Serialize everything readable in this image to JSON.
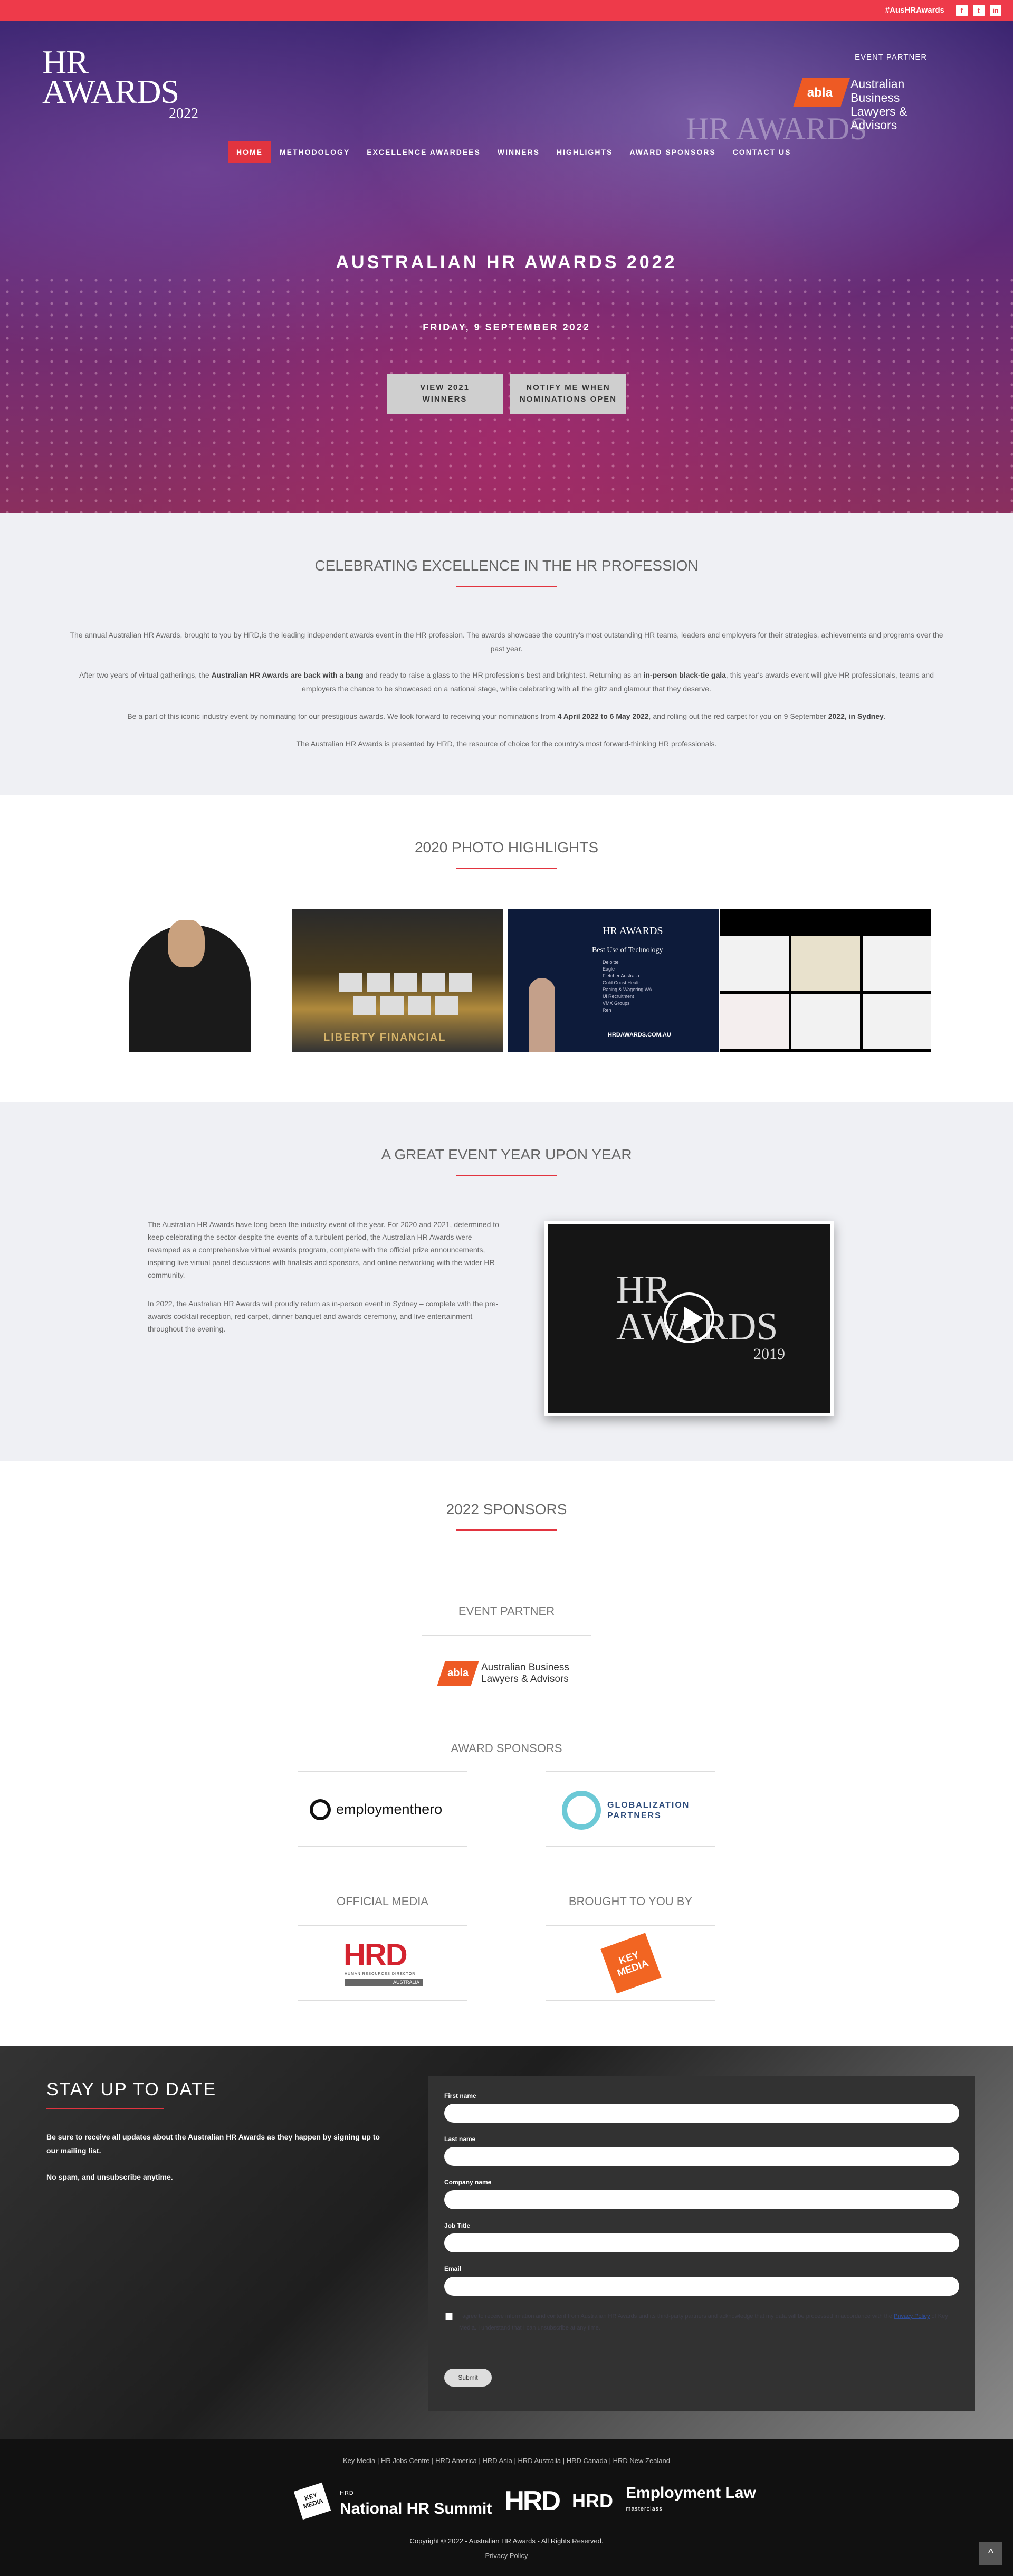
{
  "topbar": {
    "hashtag": "#AusHRAwards",
    "social": [
      {
        "icon": "facebook-icon",
        "glyph": "f"
      },
      {
        "icon": "twitter-icon",
        "glyph": "t"
      },
      {
        "icon": "linkedin-icon",
        "glyph": "in"
      }
    ]
  },
  "header": {
    "logo_line1": "HR",
    "logo_line2": "AWARDS",
    "logo_year": "2022",
    "partner_label": "EVENT PARTNER",
    "partner_mark": "abla",
    "partner_name_1": "Australian Business",
    "partner_name_2": "Lawyers & Advisors",
    "watermark": "HR AWARDS"
  },
  "nav": {
    "items": [
      "HOME",
      "METHODOLOGY",
      "EXCELLENCE AWARDEES",
      "WINNERS",
      "HIGHLIGHTS",
      "AWARD SPONSORS",
      "CONTACT US"
    ],
    "active_index": 0
  },
  "hero": {
    "title": "AUSTRALIAN HR AWARDS 2022",
    "date": "FRIDAY, 9 SEPTEMBER 2022",
    "button1_line1": "VIEW 2021",
    "button1_line2": "WINNERS",
    "button2_line1": "NOTIFY ME WHEN",
    "button2_line2": "NOMINATIONS OPEN"
  },
  "celebrating": {
    "title": "CELEBRATING EXCELLENCE IN THE HR PROFESSION",
    "p1": "The annual Australian HR Awards, brought to you by HRD,is the leading independent awards event in the HR profession. The awards showcase the country's most outstanding HR teams, leaders and employers for their strategies, achievements and programs over the past year.",
    "p2_a": "After two years of virtual gatherings, the ",
    "p2_b": "Australian HR Awards are back with a bang",
    "p2_c": " and ready to raise a glass to the HR profession's best and brightest. Returning as an ",
    "p2_d": "in-person black-tie gala",
    "p2_e": ", this year's awards event will give HR professionals, teams and employers the chance to be showcased on a national stage, while celebrating with all the glitz and glamour that they deserve.",
    "p3_a": "Be a part of this iconic industry event by nominating for our prestigious awards. We look forward to receiving your nominations from ",
    "p3_b": "4 April 2022 to 6 May 2022",
    "p3_c": ", and rolling out the red carpet for you on 9 September ",
    "p3_d": "2022, in Sydney",
    "p3_e": ".",
    "p4": "The Australian HR Awards is presented by HRD, the resource of choice for the country's most forward-thinking HR professionals."
  },
  "highlights": {
    "title": "2020 PHOTO HIGHLIGHTS",
    "photo3_logo": "HR AWARDS",
    "photo3_heading": "Best Use of Technology",
    "photo3_list": [
      "Deloitte",
      "Eagle",
      "Fletcher Australia",
      "Gold Coast Health",
      "Racing & Wagering WA",
      "Ui Recruitment",
      "VMX Groups",
      "Ren"
    ],
    "photo3_url": "HRDAWARDS.COM.AU",
    "photo2_caption": "LIBERTY FINANCIAL"
  },
  "event_year": {
    "title": "A GREAT EVENT YEAR UPON YEAR",
    "p1": "The Australian HR Awards have long been the industry event of the year. For 2020 and 2021, determined to keep celebrating the sector despite the events of a turbulent period, the Australian HR Awards were revamped as a comprehensive virtual awards program, complete with the official prize announcements, inspiring live virtual panel discussions with finalists and sponsors, and online networking with the wider HR community.",
    "p2": "In 2022, the Australian HR Awards will proudly return as in-person event in Sydney – complete with the pre-awards cocktail reception, red carpet, dinner banquet and awards ceremony, and live entertainment throughout the evening.",
    "video_title_1": "HR",
    "video_title_2": "AWARDS",
    "video_year": "2019"
  },
  "sponsors": {
    "title": "2022 SPONSORS",
    "event_partner_label": "EVENT PARTNER",
    "award_sponsors_label": "AWARD SPONSORS",
    "official_media_label": "OFFICIAL MEDIA",
    "brought_label": "BROUGHT TO YOU BY",
    "abla_mark": "abla",
    "abla_1": "Australian Business",
    "abla_2": "Lawyers & Advisors",
    "employment_hero": "employmenthero",
    "globalization_1": "GLOBALIZATION",
    "globalization_2": "PARTNERS",
    "hrd": "HRD",
    "hrd_sub": "HUMAN RESOURCES DIRECTOR",
    "hrd_country": "AUSTRALIA",
    "keymedia_1": "KEY",
    "keymedia_2": "MEDIA"
  },
  "newsletter": {
    "title": "STAY UP TO DATE",
    "text1": "Be sure to receive all updates about the Australian HR Awards as they happen by signing up to our mailing list.",
    "text2": "No spam, and unsubscribe anytime.",
    "fields": {
      "first_name": "First name",
      "last_name": "Last name",
      "company": "Company name",
      "job_title": "Job Title",
      "email": "Email"
    },
    "consent_a": "I agree to receive information and content from Australian HR Awards and its third-party partners and acknowledge that my data will be processed in accordance with the ",
    "consent_link": "Privacy Policy",
    "consent_b": " of Key Media. I understand that I can unsubscribe at any time.",
    "submit": "Submit"
  },
  "footer": {
    "links": [
      "Key Media",
      "HR Jobs Centre",
      "HRD America",
      "HRD Asia",
      "HRD Australia",
      "HRD Canada",
      "HRD New Zealand"
    ],
    "brand_key_media": "KEY MEDIA",
    "brand_summit": "National HR Summit",
    "brand_summit_sub": "HRD",
    "brand_hrd1": "HRD",
    "brand_hrd2": "HRD",
    "brand_law": "Employment Law",
    "brand_law_sub": "masterclass",
    "copyright": "Copyright © 2022 - Australian HR Awards - All Rights Reserved.",
    "privacy": "Privacy Policy",
    "to_top": "^"
  },
  "colors": {
    "accent": "#e2343f",
    "topbar": "#ee3a4a",
    "section_grey": "#eff0f4",
    "footer": "#111111"
  }
}
